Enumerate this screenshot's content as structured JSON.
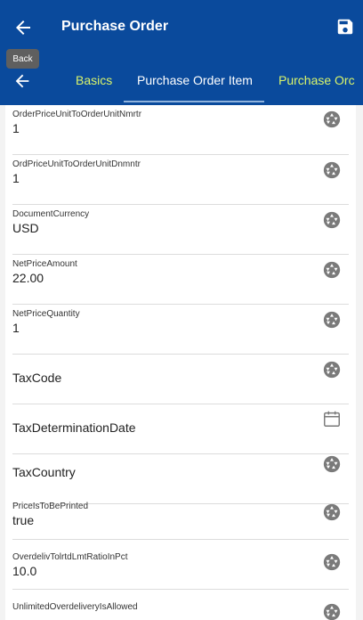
{
  "header": {
    "title": "Purchase Order",
    "tooltip": "Back"
  },
  "tabs": [
    {
      "label": "Basics"
    },
    {
      "label": "Purchase Order Item"
    },
    {
      "label": "Purchase Orc"
    }
  ],
  "fields": [
    {
      "label": "OrderPriceUnitToOrderUnitNmrtr",
      "value": "1",
      "icon": "aperture-icon"
    },
    {
      "label": "OrdPriceUnitToOrderUnitDnmntr",
      "value": "1",
      "icon": "aperture-icon"
    },
    {
      "label": "DocumentCurrency",
      "value": "USD",
      "icon": "aperture-icon"
    },
    {
      "label": "NetPriceAmount",
      "value": "22.00",
      "icon": "aperture-icon"
    },
    {
      "label": "NetPriceQuantity",
      "value": "1",
      "icon": "aperture-icon"
    },
    {
      "label": "TaxCode",
      "value": "",
      "icon": "aperture-icon"
    },
    {
      "label": "TaxDeterminationDate",
      "value": "",
      "icon": "calendar-icon"
    },
    {
      "label": "TaxCountry",
      "value": "",
      "icon": "aperture-icon"
    },
    {
      "label": "PriceIsToBePrinted",
      "value": "true",
      "icon": "aperture-icon"
    },
    {
      "label": "OverdelivTolrtdLmtRatioInPct",
      "value": "10.0",
      "icon": "aperture-icon"
    },
    {
      "label": "UnlimitedOverdeliveryIsAllowed",
      "value": "",
      "icon": "aperture-icon"
    }
  ]
}
